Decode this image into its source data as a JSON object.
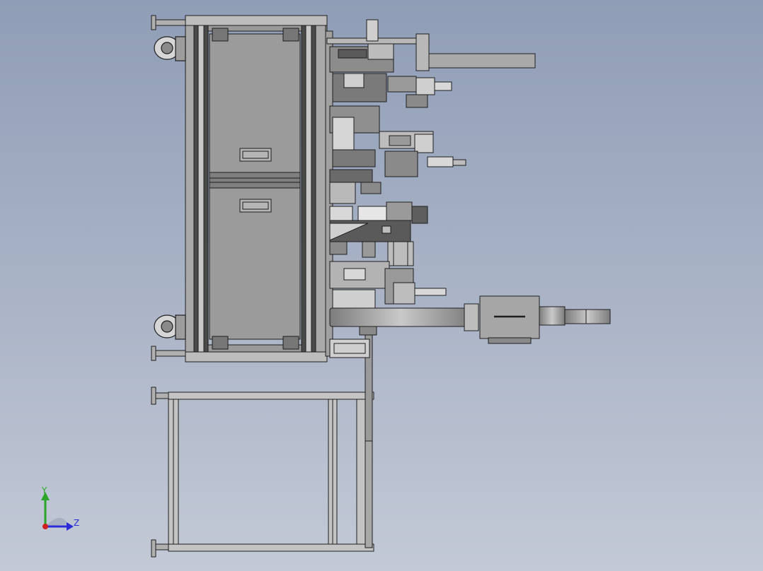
{
  "viewport": {
    "background_top": "#8f9db6",
    "background_bottom": "#c3c9d6"
  },
  "triad": {
    "y_label": "Y",
    "z_label": "Z",
    "y_color": "#2aa52a",
    "z_color": "#2b2bd8",
    "x_color": "#d02020"
  }
}
